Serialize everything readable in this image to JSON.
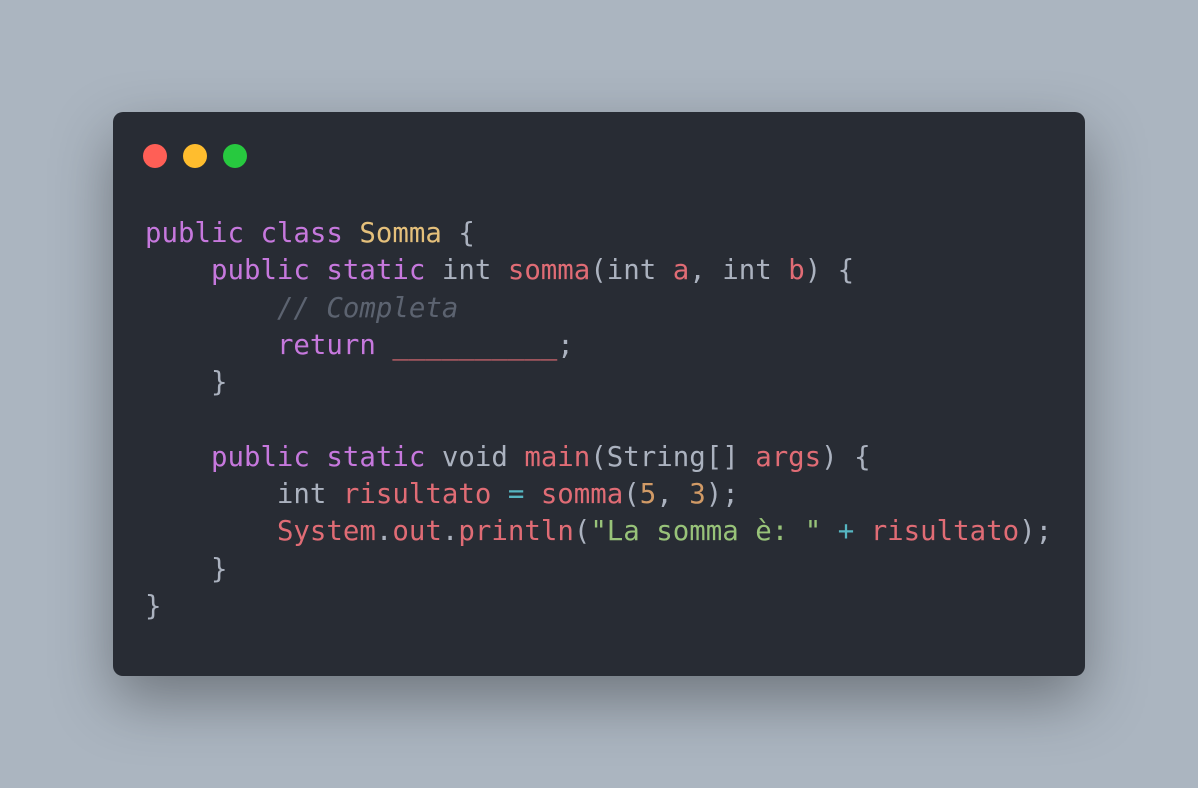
{
  "window": {
    "controls": {
      "close_color": "#ff5f56",
      "minimize_color": "#ffbd2e",
      "maximize_color": "#27c93f"
    }
  },
  "colors": {
    "background": "#abb5c0",
    "editor": "#282c34",
    "keyword": "#c678dd",
    "class_name": "#e5c07b",
    "identifier": "#e06c75",
    "number": "#d19a66",
    "string": "#98c379",
    "operator": "#56b6c2",
    "comment": "#5c6370",
    "plain": "#abb2bf"
  },
  "code": {
    "language": "Java",
    "lines": [
      [
        {
          "t": "public",
          "k": "kw"
        },
        {
          "t": " ",
          "k": "plain"
        },
        {
          "t": "class",
          "k": "kw"
        },
        {
          "t": " ",
          "k": "plain"
        },
        {
          "t": "Somma",
          "k": "cls"
        },
        {
          "t": " {",
          "k": "plain"
        }
      ],
      [
        {
          "t": "    ",
          "k": "plain"
        },
        {
          "t": "public",
          "k": "kw"
        },
        {
          "t": " ",
          "k": "plain"
        },
        {
          "t": "static",
          "k": "kw"
        },
        {
          "t": " int ",
          "k": "plain"
        },
        {
          "t": "somma",
          "k": "fn"
        },
        {
          "t": "(int ",
          "k": "plain"
        },
        {
          "t": "a",
          "k": "var"
        },
        {
          "t": ", int ",
          "k": "plain"
        },
        {
          "t": "b",
          "k": "var"
        },
        {
          "t": ") {",
          "k": "plain"
        }
      ],
      [
        {
          "t": "        ",
          "k": "plain"
        },
        {
          "t": "// Completa",
          "k": "cm"
        }
      ],
      [
        {
          "t": "        ",
          "k": "plain"
        },
        {
          "t": "return",
          "k": "kw"
        },
        {
          "t": " ",
          "k": "plain"
        },
        {
          "t": "__________",
          "k": "var"
        },
        {
          "t": ";",
          "k": "plain"
        }
      ],
      [
        {
          "t": "    }",
          "k": "plain"
        }
      ],
      [],
      [
        {
          "t": "    ",
          "k": "plain"
        },
        {
          "t": "public",
          "k": "kw"
        },
        {
          "t": " ",
          "k": "plain"
        },
        {
          "t": "static",
          "k": "kw"
        },
        {
          "t": " void ",
          "k": "plain"
        },
        {
          "t": "main",
          "k": "fn"
        },
        {
          "t": "(String[] ",
          "k": "plain"
        },
        {
          "t": "args",
          "k": "var"
        },
        {
          "t": ") {",
          "k": "plain"
        }
      ],
      [
        {
          "t": "        int ",
          "k": "plain"
        },
        {
          "t": "risultato",
          "k": "var"
        },
        {
          "t": " ",
          "k": "plain"
        },
        {
          "t": "=",
          "k": "op"
        },
        {
          "t": " ",
          "k": "plain"
        },
        {
          "t": "somma",
          "k": "fn"
        },
        {
          "t": "(",
          "k": "plain"
        },
        {
          "t": "5",
          "k": "num"
        },
        {
          "t": ", ",
          "k": "plain"
        },
        {
          "t": "3",
          "k": "num"
        },
        {
          "t": ");",
          "k": "plain"
        }
      ],
      [
        {
          "t": "        ",
          "k": "plain"
        },
        {
          "t": "System",
          "k": "var"
        },
        {
          "t": ".",
          "k": "plain"
        },
        {
          "t": "out",
          "k": "var"
        },
        {
          "t": ".",
          "k": "plain"
        },
        {
          "t": "println",
          "k": "fn"
        },
        {
          "t": "(",
          "k": "plain"
        },
        {
          "t": "\"La somma è: \"",
          "k": "str"
        },
        {
          "t": " ",
          "k": "plain"
        },
        {
          "t": "+",
          "k": "op"
        },
        {
          "t": " ",
          "k": "plain"
        },
        {
          "t": "risultato",
          "k": "var"
        },
        {
          "t": ");",
          "k": "plain"
        }
      ],
      [
        {
          "t": "    }",
          "k": "plain"
        }
      ],
      [
        {
          "t": "}",
          "k": "plain"
        }
      ]
    ]
  }
}
